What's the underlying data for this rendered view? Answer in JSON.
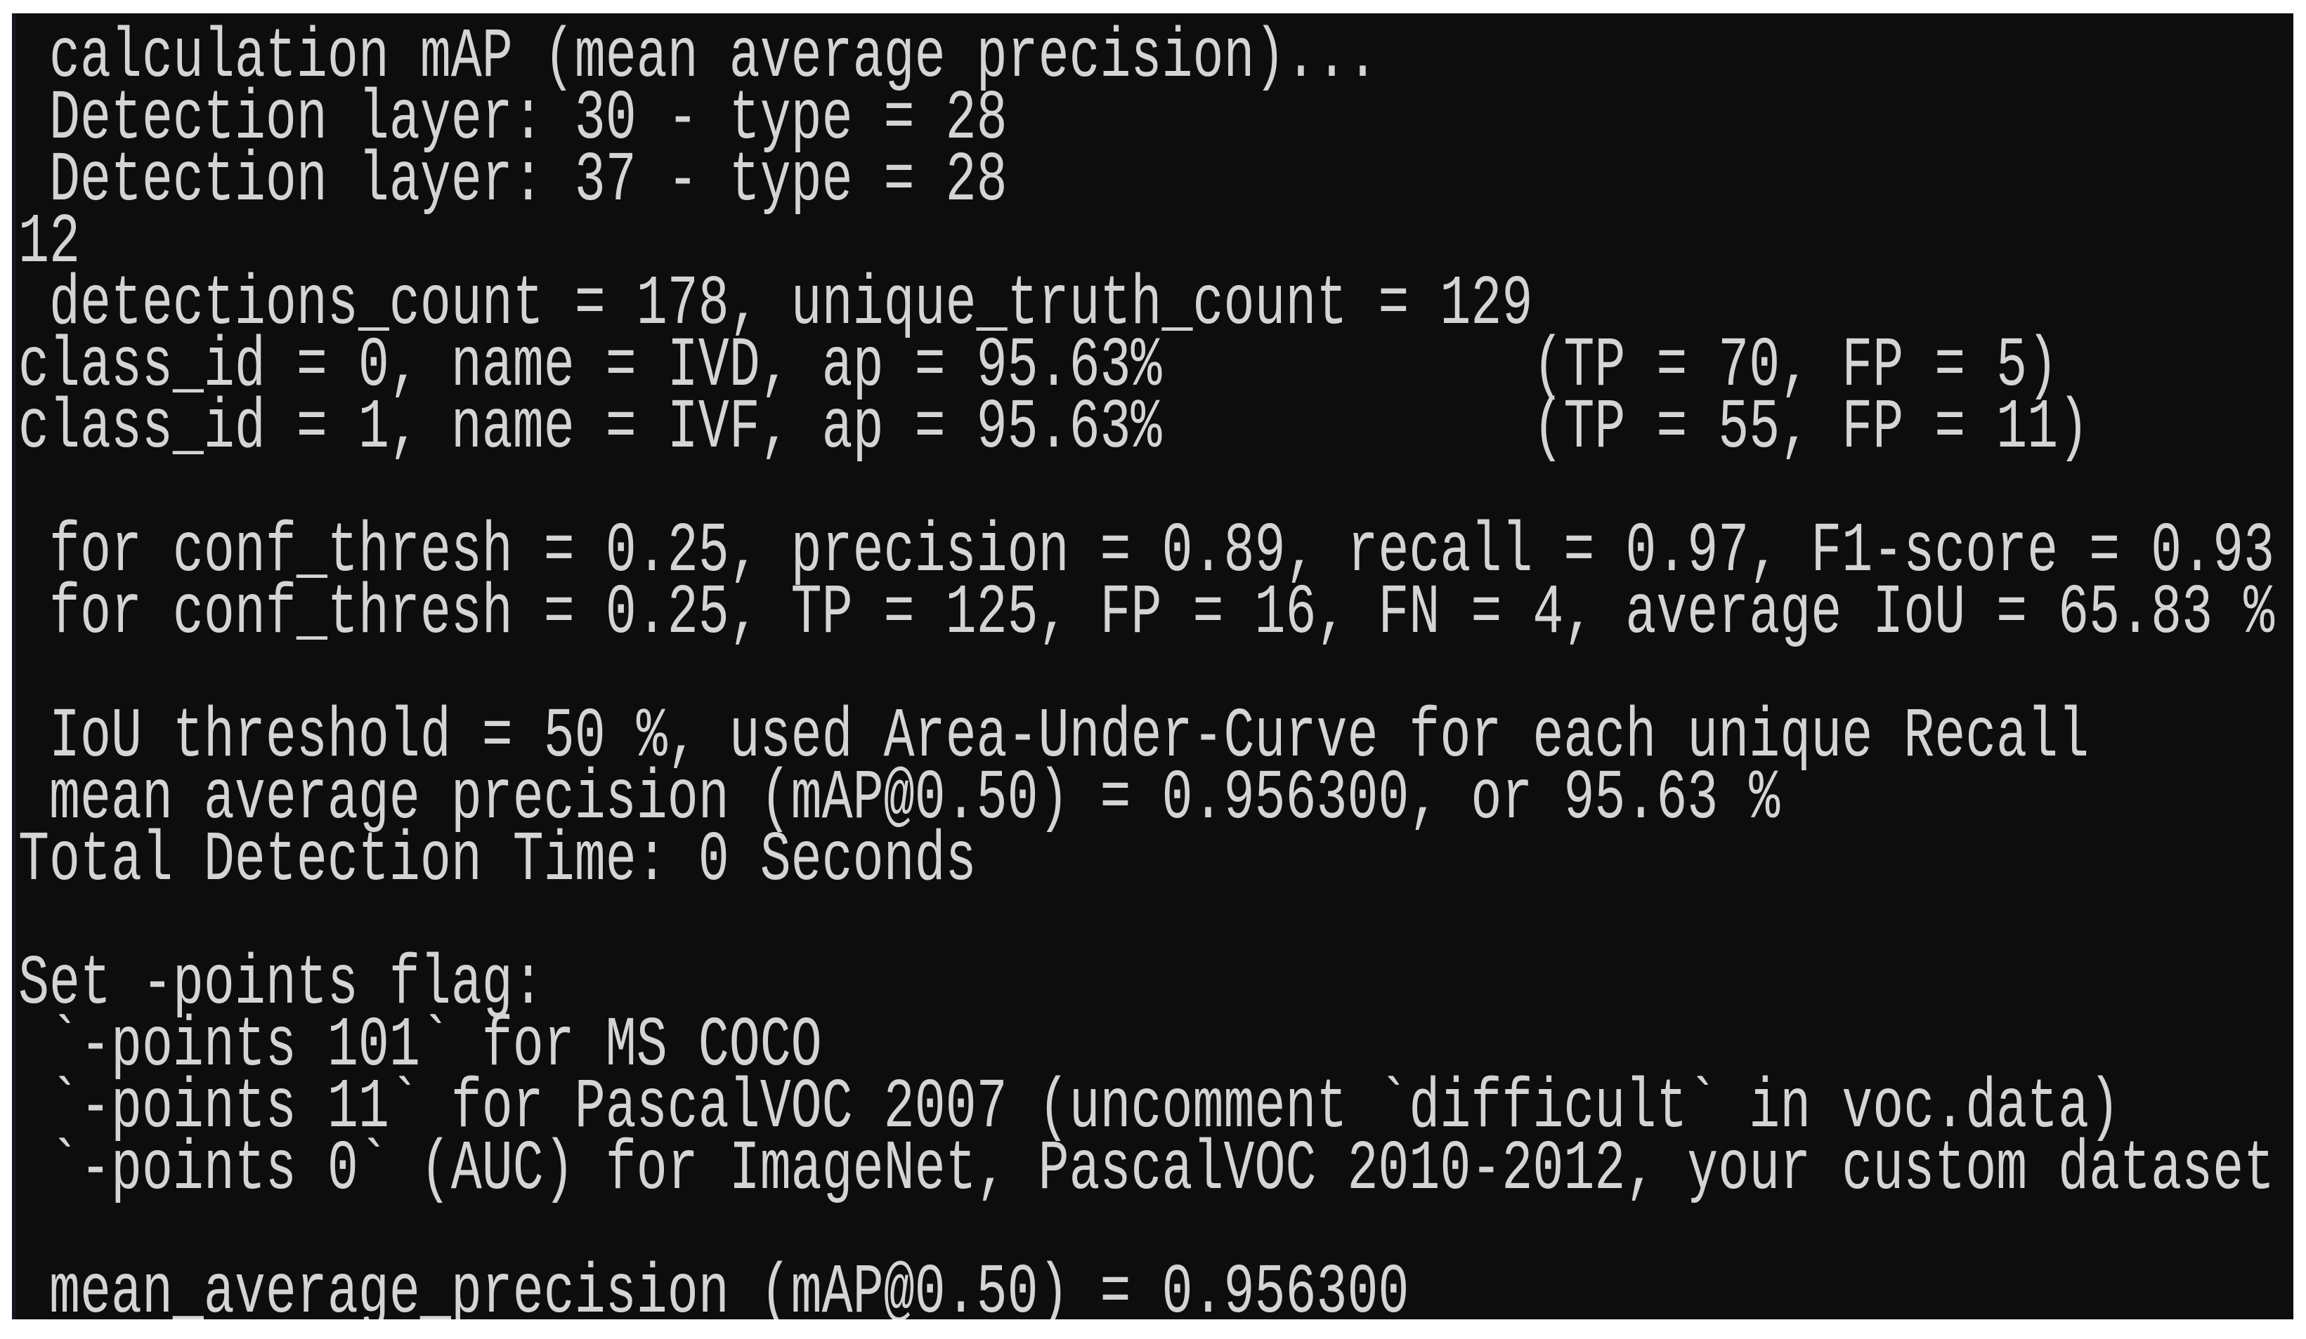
{
  "window": {
    "type": "console",
    "background_color": "#0d0d0d",
    "text_color": "#d4d4d4"
  },
  "console": {
    "lines": [
      " calculation mAP (mean average precision)...",
      " Detection layer: 30 - type = 28",
      " Detection layer: 37 - type = 28",
      "12",
      " detections_count = 178, unique_truth_count = 129",
      "class_id = 0, name = IVD, ap = 95.63%            (TP = 70, FP = 5)",
      "class_id = 1, name = IVF, ap = 95.63%            (TP = 55, FP = 11)",
      "",
      " for conf_thresh = 0.25, precision = 0.89, recall = 0.97, F1-score = 0.93",
      " for conf_thresh = 0.25, TP = 125, FP = 16, FN = 4, average IoU = 65.83 %",
      "",
      " IoU threshold = 50 %, used Area-Under-Curve for each unique Recall",
      " mean average precision (mAP@0.50) = 0.956300, or 95.63 %",
      "Total Detection Time: 0 Seconds",
      "",
      "Set -points flag:",
      " `-points 101` for MS COCO",
      " `-points 11` for PascalVOC 2007 (uncomment `difficult` in voc.data)",
      " `-points 0` (AUC) for ImageNet, PascalVOC 2010-2012, your custom dataset",
      "",
      " mean_average_precision (mAP@0.50) = 0.956300"
    ]
  },
  "results": {
    "detection_layers": [
      {
        "layer": 30,
        "type": 28
      },
      {
        "layer": 37,
        "type": 28
      }
    ],
    "detections_count": 178,
    "unique_truth_count": 129,
    "classes": [
      {
        "class_id": 0,
        "name": "IVD",
        "ap": "95.63%",
        "TP": 70,
        "FP": 5
      },
      {
        "class_id": 1,
        "name": "IVF",
        "ap": "95.63%",
        "TP": 55,
        "FP": 11
      }
    ],
    "conf_thresh": 0.25,
    "precision": 0.89,
    "recall": 0.97,
    "f1_score": 0.93,
    "TP": 125,
    "FP": 16,
    "FN": 4,
    "average_iou": "65.83 %",
    "iou_threshold": "50 %",
    "map_050": 0.9563,
    "map_050_percent": "95.63 %",
    "total_detection_time": "0 Seconds"
  }
}
